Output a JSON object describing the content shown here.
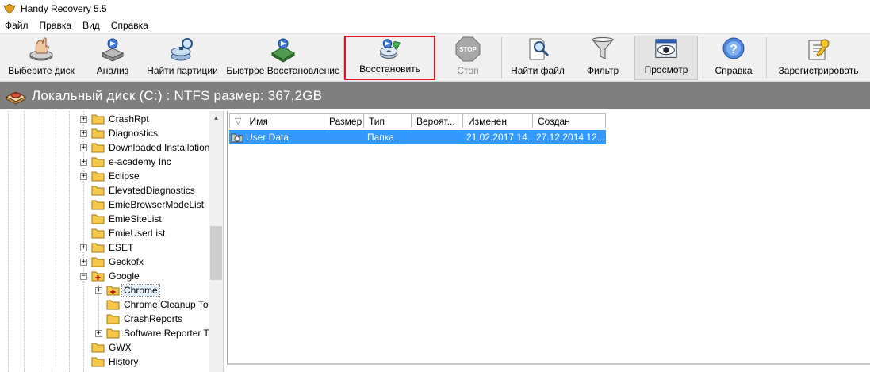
{
  "window": {
    "title": "Handy Recovery 5.5"
  },
  "menu": [
    "Файл",
    "Правка",
    "Вид",
    "Справка"
  ],
  "toolbar": {
    "select_disk": "Выберите диск",
    "analyze": "Анализ",
    "find_partitions": "Найти партиции",
    "quick_restore": "Быстрое Восстановление",
    "restore": "Восстановить",
    "stop": "Стоп",
    "find_file": "Найти файл",
    "filter": "Фильтр",
    "view": "Просмотр",
    "help": "Справка",
    "register": "Зарегистрировать"
  },
  "drive": {
    "title": "Локальный диск (C:) : NTFS размер: 367,2GB"
  },
  "tree": [
    {
      "label": "CrashRpt",
      "expander": "+",
      "level": 0
    },
    {
      "label": "Diagnostics",
      "expander": "+",
      "level": 0
    },
    {
      "label": "Downloaded Installation",
      "expander": "+",
      "level": 0
    },
    {
      "label": "e-academy Inc",
      "expander": "+",
      "level": 0
    },
    {
      "label": "Eclipse",
      "expander": "+",
      "level": 0
    },
    {
      "label": "ElevatedDiagnostics",
      "expander": "",
      "level": 0
    },
    {
      "label": "EmieBrowserModeList",
      "expander": "",
      "level": 0
    },
    {
      "label": "EmieSiteList",
      "expander": "",
      "level": 0
    },
    {
      "label": "EmieUserList",
      "expander": "",
      "level": 0
    },
    {
      "label": "ESET",
      "expander": "+",
      "level": 0
    },
    {
      "label": "Geckofx",
      "expander": "+",
      "level": 0
    },
    {
      "label": "Google",
      "expander": "−",
      "level": 0
    },
    {
      "label": "Chrome",
      "expander": "+",
      "level": 1
    },
    {
      "label": "Chrome Cleanup To",
      "expander": "",
      "level": 1
    },
    {
      "label": "CrashReports",
      "expander": "",
      "level": 1
    },
    {
      "label": "Software Reporter To",
      "expander": "+",
      "level": 1
    },
    {
      "label": "GWX",
      "expander": "",
      "level": 0
    },
    {
      "label": "History",
      "expander": "",
      "level": 0
    }
  ],
  "list": {
    "columns": [
      "Имя",
      "Размер",
      "Тип",
      "Вероят...",
      "Изменен",
      "Создан"
    ],
    "sort_indicator": "▽",
    "rows": [
      {
        "name": "User Data",
        "size": "",
        "type": "Папка",
        "prob": "",
        "modified": "21.02.2017 14...",
        "created": "27.12.2014 12..."
      }
    ]
  },
  "colors": {
    "selection": "#3399ff",
    "highlight": "#e0141e",
    "drivebar": "#7f7f7f",
    "folder": "#f7c84a"
  }
}
